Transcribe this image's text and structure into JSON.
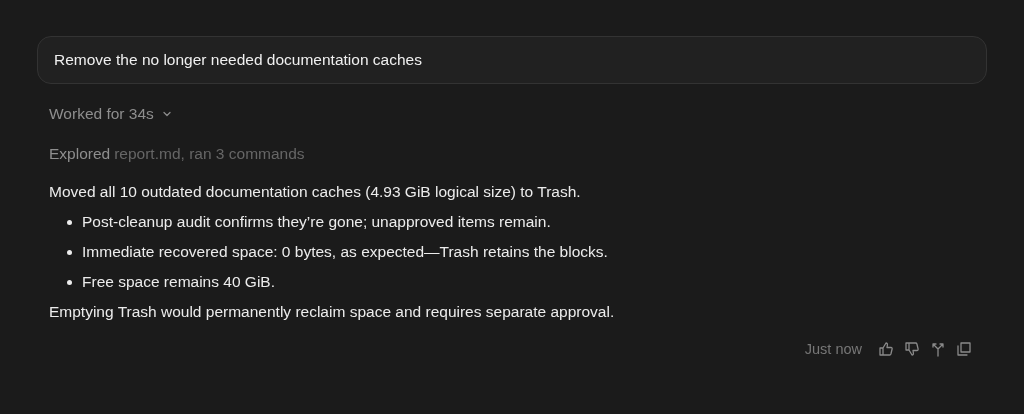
{
  "prompt": {
    "text": "Remove the no longer needed documentation caches"
  },
  "worked": {
    "label": "Worked for 34s",
    "expanded": false
  },
  "explored": {
    "label": "Explored",
    "detail": "report.md, ran 3 commands"
  },
  "summary": "Moved all 10 outdated documentation caches (4.93 GiB logical size) to Trash.",
  "bullets": [
    "Post-cleanup audit confirms they’re gone; unapproved items remain.",
    "Immediate recovered space: 0 bytes, as expected—Trash retains the blocks.",
    "Free space remains 40 GiB."
  ],
  "closing": "Emptying Trash would permanently reclaim space and requires separate approval.",
  "footer": {
    "time": "Just now"
  }
}
